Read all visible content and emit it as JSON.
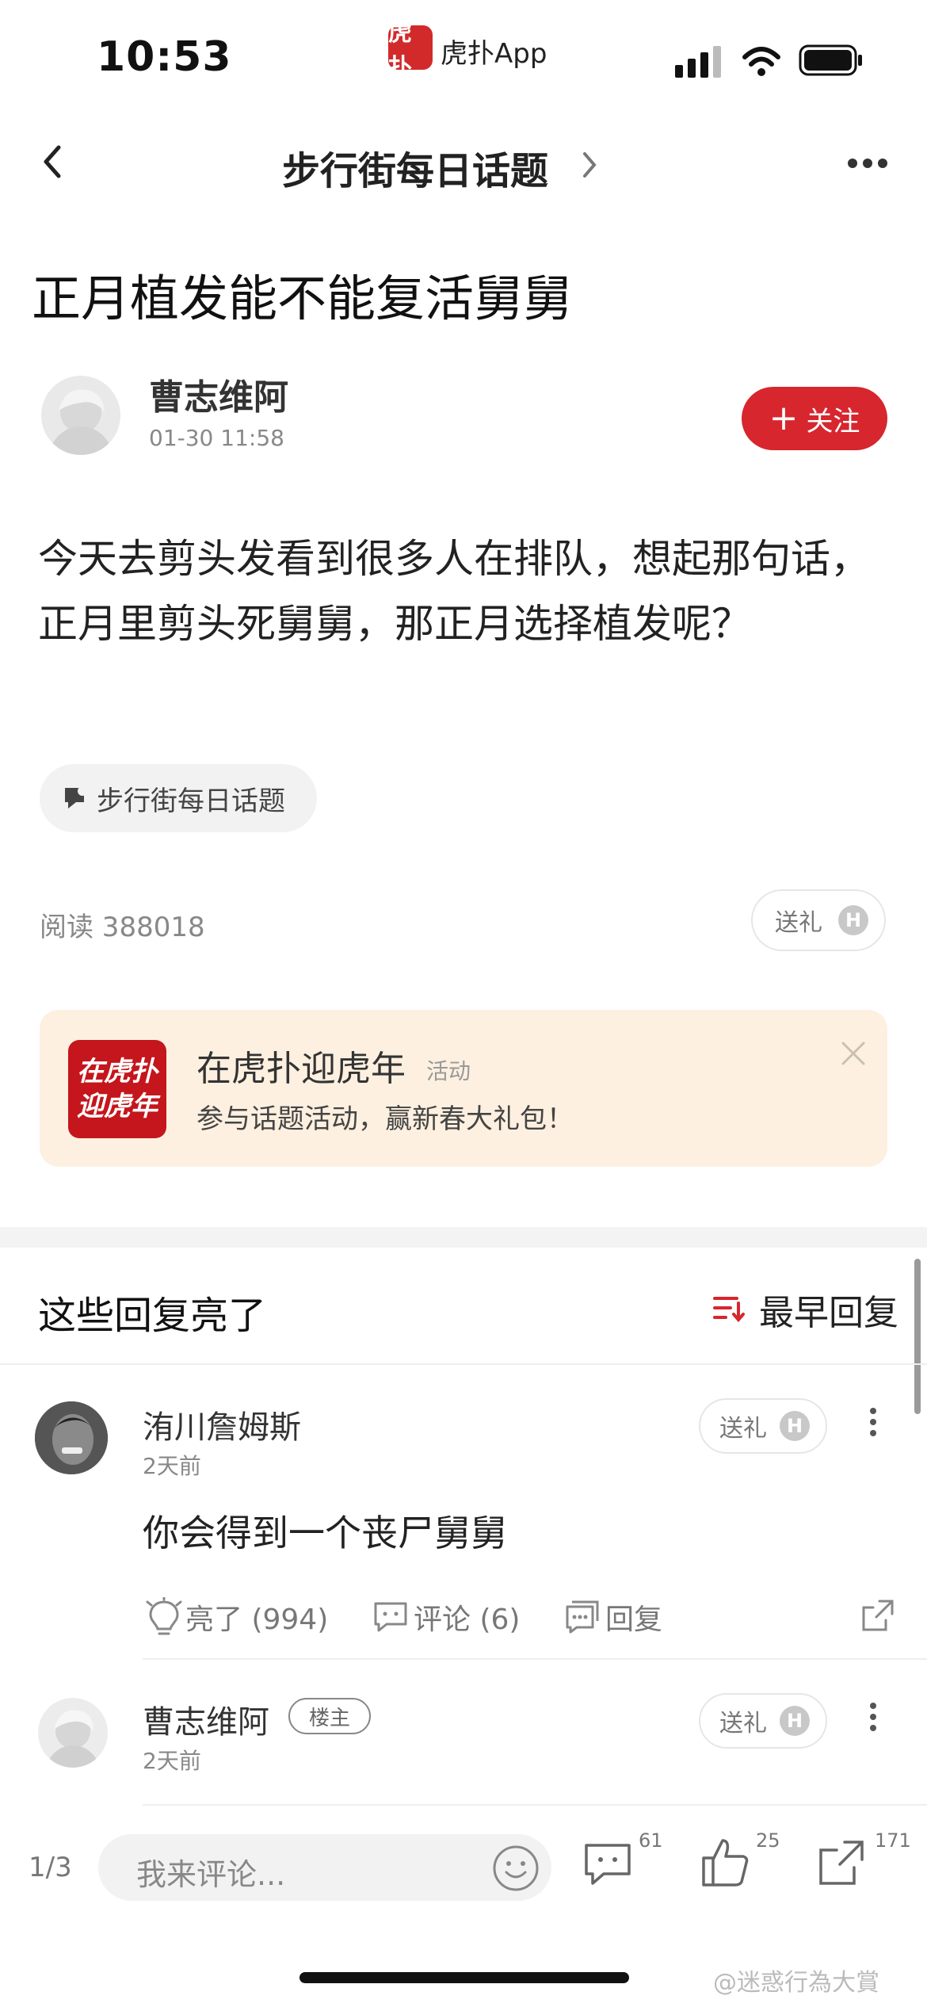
{
  "status_bar": {
    "time": "10:53",
    "app_logo": "虎扑",
    "app_name": "虎扑App"
  },
  "nav": {
    "title": "步行街每日话题"
  },
  "post": {
    "title": "正月植发能不能复活舅舅",
    "author": "曹志维阿",
    "time": "01-30 11:58",
    "follow_label": "关注",
    "body": "今天去剪头发看到很多人在排队，想起那句话，正月里剪头死舅舅，那正月选择植发呢？",
    "topic_tag": "步行街每日话题",
    "reads": "阅读 388018",
    "gift_label": "送礼",
    "coin_letter": "H"
  },
  "banner": {
    "logo_line1": "在虎扑",
    "logo_line2": "迎虎年",
    "title": "在虎扑迎虎年",
    "tag": "活动",
    "subtitle": "参与话题活动，赢新春大礼包！"
  },
  "replies": {
    "section_title": "这些回复亮了",
    "sort_label": "最早回复",
    "items": [
      {
        "name": "洧川詹姆斯",
        "time": "2天前",
        "text": "你会得到一个丧尸舅舅",
        "gift_label": "送礼",
        "light_label": "亮了 (994)",
        "comment_label": "评论 (6)",
        "reply_label": "回复"
      },
      {
        "name": "曹志维阿",
        "badge": "楼主",
        "time": "2天前",
        "gift_label": "送礼"
      }
    ]
  },
  "bottom_bar": {
    "page_indicator": "1/3",
    "input_placeholder": "我来评论...",
    "comment_count": "61",
    "like_count": "25",
    "share_count": "171"
  },
  "watermark": "@迷惑行為大賞",
  "colors": {
    "accent_red": "#d7262e",
    "banner_bg": "#fdf0e0"
  }
}
